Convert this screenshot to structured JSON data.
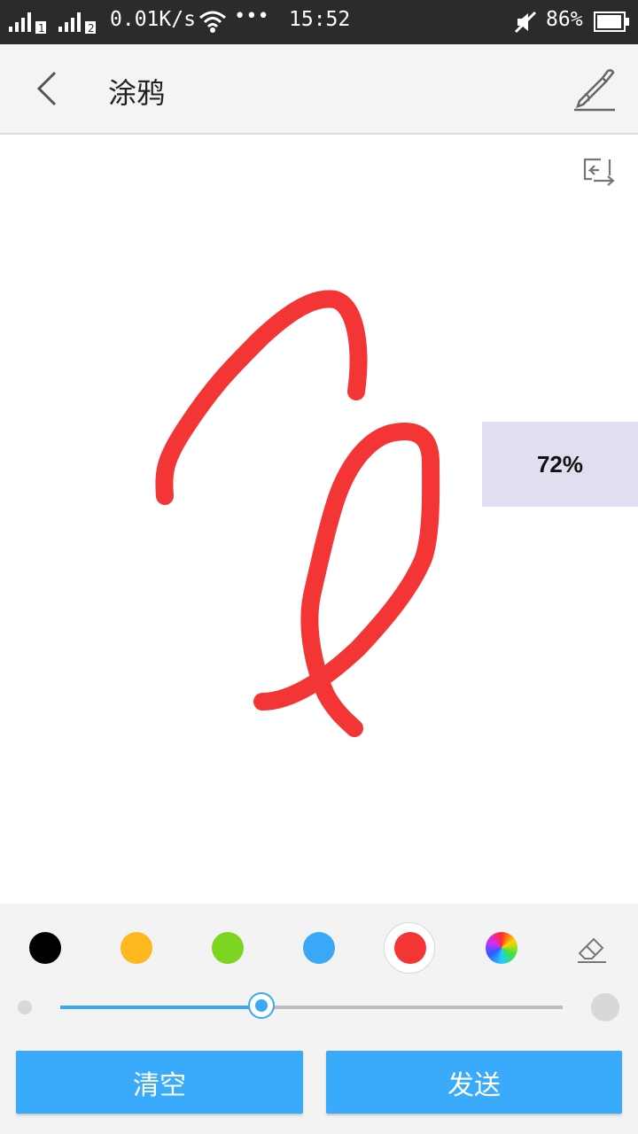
{
  "status_bar": {
    "speed": "0.01K/s",
    "dots": "•••",
    "time": "15:52",
    "battery": "86%",
    "sim1": "1",
    "sim2": "2"
  },
  "header": {
    "title": "涂鸦",
    "back_icon": "chevron-left-icon",
    "pen_icon": "pen-signature-icon"
  },
  "canvas": {
    "swap_icon": "swap-icon",
    "zoom_badge": "72%",
    "stroke_color": "#f43535"
  },
  "toolbar": {
    "colors": [
      {
        "name": "black",
        "hex": "#000000"
      },
      {
        "name": "orange",
        "hex": "#fdb71f"
      },
      {
        "name": "green",
        "hex": "#7cd621"
      },
      {
        "name": "blue",
        "hex": "#3aa8f6"
      },
      {
        "name": "red",
        "hex": "#f43535",
        "selected": true
      },
      {
        "name": "palette",
        "hex": "rainbow"
      }
    ],
    "eraser_icon": "eraser-icon",
    "brush_size_fraction": 0.4
  },
  "buttons": {
    "clear": "清空",
    "send": "发送"
  },
  "colors": {
    "accent": "#3aabfa",
    "status_bar": "#2b2b2b",
    "header_bg": "#f4f4f4"
  }
}
